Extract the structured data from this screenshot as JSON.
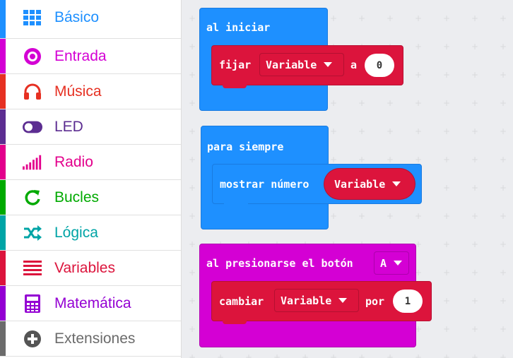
{
  "toolbox": [
    {
      "label": "Básico",
      "color": "#1e90ff",
      "icon": "grid-icon"
    },
    {
      "label": "Entrada",
      "color": "#d400d4",
      "icon": "radio-button-icon"
    },
    {
      "label": "Música",
      "color": "#e63022",
      "icon": "headphones-icon"
    },
    {
      "label": "LED",
      "color": "#5c2d91",
      "icon": "toggle-icon"
    },
    {
      "label": "Radio",
      "color": "#e3008c",
      "icon": "signal-bars-icon"
    },
    {
      "label": "Bucles",
      "color": "#00aa00",
      "icon": "loop-arrow-icon"
    },
    {
      "label": "Lógica",
      "color": "#00a4a6",
      "icon": "shuffle-icon"
    },
    {
      "label": "Variables",
      "color": "#dc143c",
      "icon": "list-lines-icon"
    },
    {
      "label": "Matemática",
      "color": "#9400d3",
      "icon": "calculator-icon"
    },
    {
      "label": "Extensiones",
      "color": "#6b6b6b",
      "icon": "plus-circle-icon"
    }
  ],
  "blocks": {
    "on_start": {
      "label": "al iniciar",
      "color": "#1e90ff",
      "inner": {
        "verb": "fijar",
        "variable": "Variable",
        "connector": "a",
        "value": "0",
        "color": "#dc143c"
      }
    },
    "forever": {
      "label": "para siempre",
      "color": "#1e90ff",
      "inner": {
        "verb": "mostrar número",
        "variable": "Variable",
        "color": "#1e90ff",
        "pill_color": "#dc143c"
      }
    },
    "on_button": {
      "label": "al presionarse el botón",
      "button": "A",
      "color": "#d400d4",
      "inner": {
        "verb": "cambiar",
        "variable": "Variable",
        "connector": "por",
        "value": "1",
        "color": "#dc143c"
      }
    }
  }
}
